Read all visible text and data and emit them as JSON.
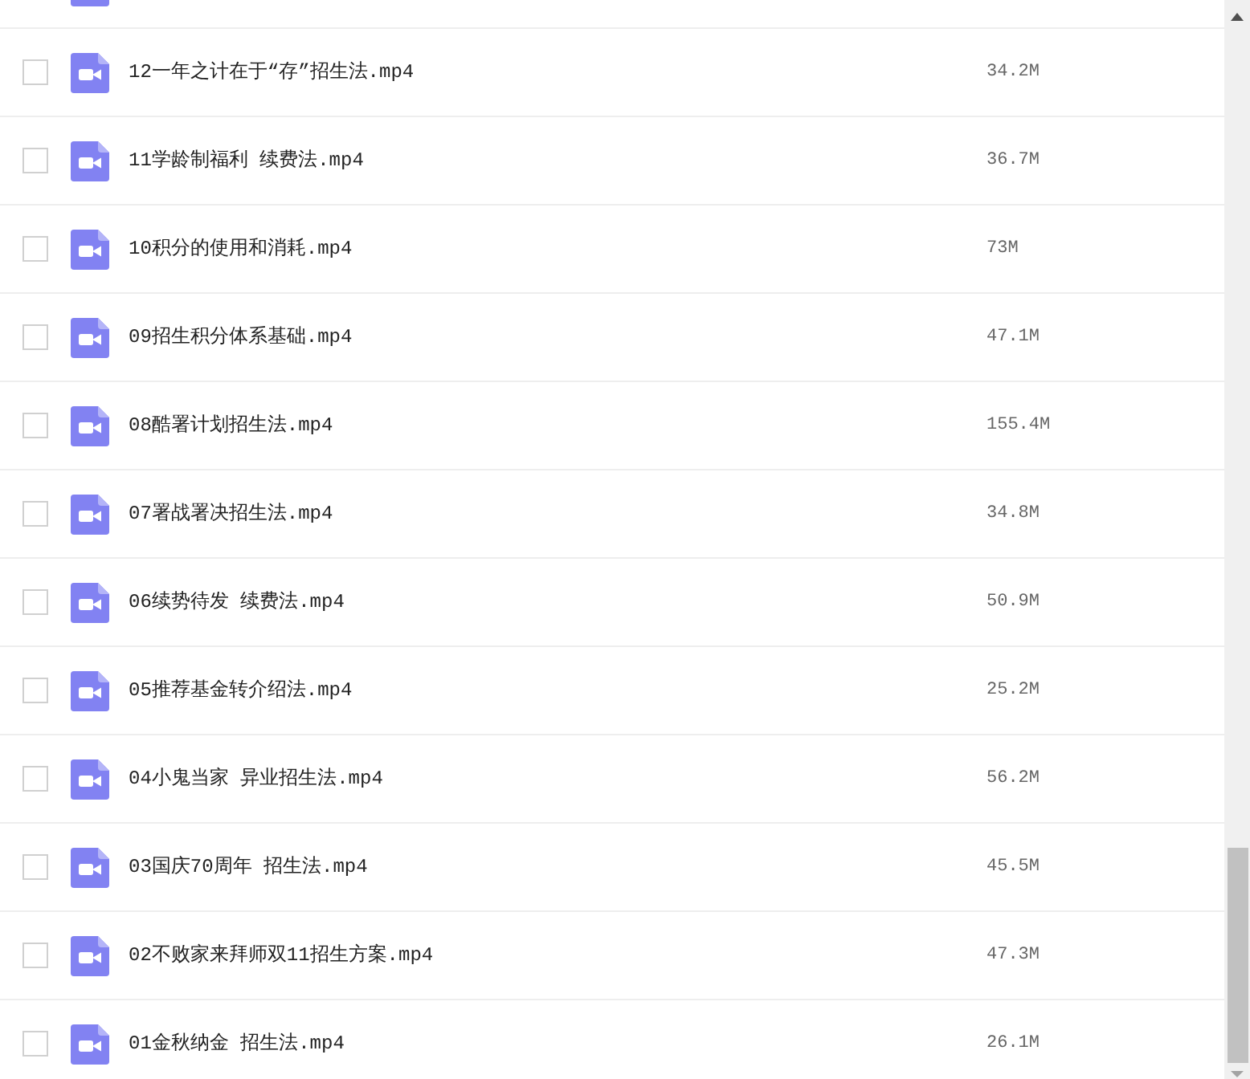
{
  "list": {
    "cut_off_row_above": true,
    "files": [
      {
        "name": "12一年之计在于“存”招生法.mp4",
        "size": "34.2M",
        "checked": false
      },
      {
        "name": "11学龄制福利 续费法.mp4",
        "size": "36.7M",
        "checked": false
      },
      {
        "name": "10积分的使用和消耗.mp4",
        "size": "73M",
        "checked": false
      },
      {
        "name": "09招生积分体系基础.mp4",
        "size": "47.1M",
        "checked": false
      },
      {
        "name": "08酷署计划招生法.mp4",
        "size": "155.4M",
        "checked": false
      },
      {
        "name": "07署战署决招生法.mp4",
        "size": "34.8M",
        "checked": false
      },
      {
        "name": "06续势待发 续费法.mp4",
        "size": "50.9M",
        "checked": false
      },
      {
        "name": "05推荐基金转介绍法.mp4",
        "size": "25.2M",
        "checked": false
      },
      {
        "name": "04小鬼当家 异业招生法.mp4",
        "size": "56.2M",
        "checked": false
      },
      {
        "name": "03国庆70周年 招生法.mp4",
        "size": "45.5M",
        "checked": false
      },
      {
        "name": "02不败家来拜师双11招生方案.mp4",
        "size": "47.3M",
        "checked": false
      },
      {
        "name": "01金秋纳金 招生法.mp4",
        "size": "26.1M",
        "checked": false
      }
    ]
  }
}
